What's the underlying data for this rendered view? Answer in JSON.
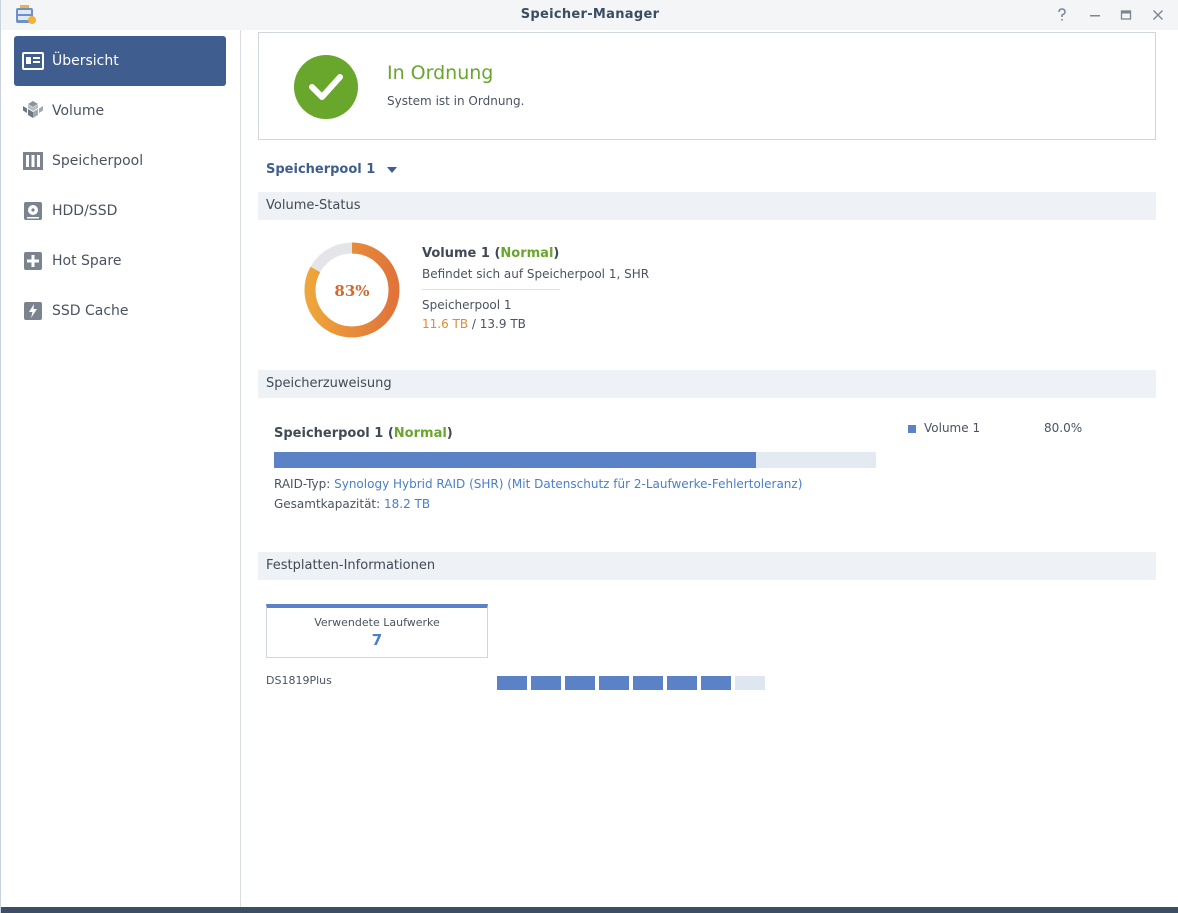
{
  "window": {
    "title": "Speicher-Manager",
    "controls": [
      "help-icon",
      "minimize-icon",
      "maximize-icon",
      "close-icon"
    ]
  },
  "sidebar": {
    "items": [
      {
        "label": "Übersicht",
        "icon": "overview-icon",
        "active": true
      },
      {
        "label": "Volume",
        "icon": "volume-icon",
        "active": false
      },
      {
        "label": "Speicherpool",
        "icon": "storage-pool-icon",
        "active": false
      },
      {
        "label": "HDD/SSD",
        "icon": "hdd-icon",
        "active": false
      },
      {
        "label": "Hot Spare",
        "icon": "hot-spare-icon",
        "active": false
      },
      {
        "label": "SSD Cache",
        "icon": "ssd-cache-icon",
        "active": false
      }
    ]
  },
  "status": {
    "title": "In Ordnung",
    "subtitle": "System ist in Ordnung."
  },
  "pool_selector": {
    "label": "Speicherpool 1"
  },
  "volume_status": {
    "header": "Volume-Status",
    "usage_percent": 83,
    "usage_label": "83%",
    "name": "Volume 1",
    "paren_open": " (",
    "state": "Normal",
    "paren_close": ")",
    "location": "Befindet sich auf Speicherpool 1, SHR",
    "pool": "Speicherpool 1",
    "used": "11.6 TB",
    "separator": " / ",
    "total": "13.9 TB"
  },
  "allocation": {
    "header": "Speicherzuweisung",
    "pool_name": "Speicherpool 1",
    "paren_open": " (",
    "pool_state": "Normal",
    "paren_close": ")",
    "fill_fraction": 0.8,
    "raid_label": "RAID-Typ: ",
    "raid_value": "Synology Hybrid RAID (SHR) (Mit Datenschutz für 2-Laufwerke-Fehlertoleranz)",
    "capacity_label": "Gesamtkapazität: ",
    "capacity_value": "18.2 TB",
    "legend": {
      "name": "Volume 1",
      "percent": "80.0%"
    }
  },
  "disks": {
    "header": "Festplatten-Informationen",
    "used_label": "Verwendete Laufwerke",
    "used_count": "7",
    "device": "DS1819Plus",
    "slots_used": 7,
    "slots_total": 8
  },
  "colors": {
    "accent": "#3f5d8e",
    "ok_green": "#68a62c",
    "usage_orange": "#e08b2e",
    "bar_blue": "#5b82c6"
  }
}
